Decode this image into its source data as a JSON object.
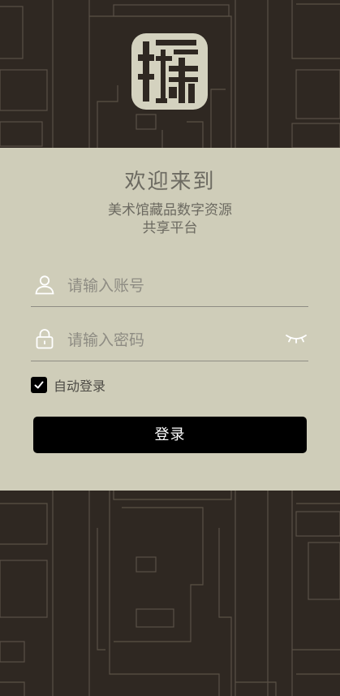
{
  "logo": {
    "name": "museum-collection-logo",
    "glyph": "藏"
  },
  "welcome": {
    "title": "欢迎来到",
    "subtitle_line1": "美术馆藏品数字资源",
    "subtitle_line2": "共享平台"
  },
  "form": {
    "account_placeholder": "请输入账号",
    "account_value": "",
    "password_placeholder": "请输入密码",
    "password_value": "",
    "remember_label": "自动登录",
    "remember_checked": true,
    "login_label": "登录"
  },
  "icons": {
    "account": "user-icon",
    "password": "lock-icon",
    "toggle": "eye-closed-icon",
    "check": "check-icon"
  },
  "colors": {
    "background": "#2f2822",
    "pattern_lines": "#5a5146",
    "panel": "#cfcdb9",
    "logo_bg": "#d4d2bf",
    "text_muted": "#6c6a61",
    "button": "#000000",
    "button_text": "#ffffff"
  }
}
